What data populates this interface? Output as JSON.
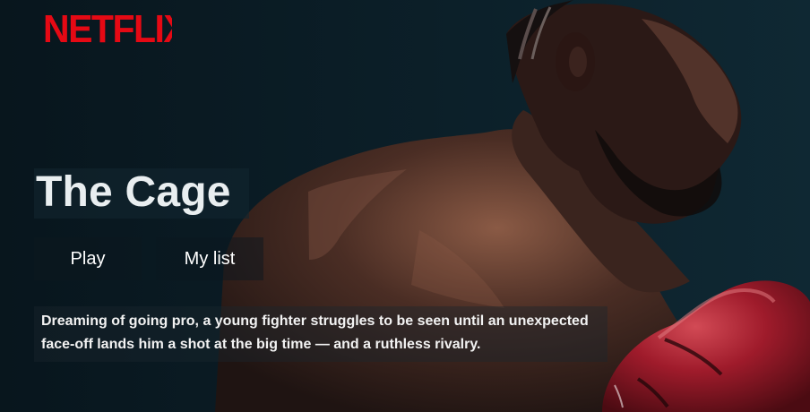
{
  "brand": {
    "name": "NETFLIX",
    "color": "#e50914"
  },
  "hero": {
    "title": "The Cage",
    "description": "Dreaming of going pro, a young fighter struggles to be seen until an unexpected face-off lands him a shot at the big time — and a ruthless rivalry."
  },
  "actions": {
    "play_label": "Play",
    "my_list_label": "My list"
  },
  "background": {
    "image": "boxer-with-red-glove"
  },
  "colors": {
    "accent": "#e50914",
    "text": "#ffffff",
    "glove": "#a5192a"
  }
}
